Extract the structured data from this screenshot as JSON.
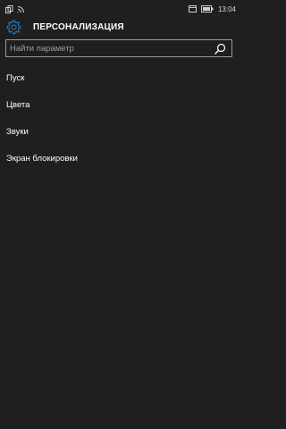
{
  "status_bar": {
    "time": "13:04",
    "icons": [
      "copy-icon",
      "wifi-icon",
      "window-icon",
      "battery-icon"
    ]
  },
  "header": {
    "title": "ПЕРСОНАЛИЗАЦИЯ",
    "icon": "gear-icon"
  },
  "search": {
    "placeholder": "Найти параметр",
    "value": "",
    "icon": "search-icon"
  },
  "menu": {
    "items": [
      {
        "label": "Пуск"
      },
      {
        "label": "Цвета"
      },
      {
        "label": "Звуки"
      },
      {
        "label": "Экран блокировки"
      }
    ]
  },
  "colors": {
    "background": "#1f1f1f",
    "accent": "#1e88d6",
    "text": "#ffffff",
    "border": "#9a9a9a"
  }
}
